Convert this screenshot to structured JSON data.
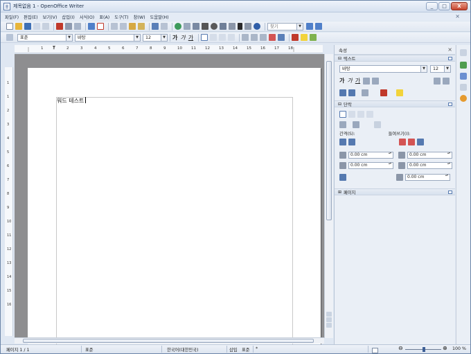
{
  "window": {
    "title": "제목없음 1 - OpenOffice Writer",
    "controls": [
      "_",
      "□",
      "X"
    ]
  },
  "menu": [
    "파일(F)",
    "편집(E)",
    "보기(V)",
    "삽입(I)",
    "서식(O)",
    "표(A)",
    "도구(T)",
    "창(W)",
    "도움말(H)"
  ],
  "toolbar": {
    "find_placeholder": "찾기"
  },
  "format_toolbar": {
    "style": "표준",
    "font": "바탕",
    "size": "12",
    "bold": "가",
    "italic": "가",
    "underline": "가"
  },
  "ruler": {
    "marks": [
      "1",
      "1",
      "2",
      "3",
      "4",
      "5",
      "6",
      "7",
      "8",
      "9",
      "10",
      "11",
      "12",
      "13",
      "14",
      "15",
      "16",
      "17",
      "18"
    ],
    "vmarks": [
      "1",
      "1",
      "2",
      "3",
      "4",
      "5",
      "6",
      "7",
      "8",
      "9",
      "10",
      "11",
      "12",
      "13",
      "14",
      "15",
      "16"
    ]
  },
  "document": {
    "text": "워드 테스트"
  },
  "sidebar": {
    "title": "속성",
    "text_section": "텍스트",
    "font": "바탕",
    "size": "12",
    "paragraph_section": "단락",
    "spacing_label": "간격(S):",
    "indent_label": "들여쓰기(I):",
    "spin_values": [
      "0.00 cm",
      "0.00 cm",
      "0.00 cm",
      "0.00 cm",
      "0.00 cm"
    ],
    "page_section": "페이지"
  },
  "statusbar": {
    "page": "페이지 1 / 1",
    "style": "표준",
    "language": "한국어(대한민국)",
    "insert_mode": "삽입",
    "selection_mode": "표준",
    "zoom": "100 %"
  },
  "colors": {
    "accent": "#5579b0",
    "document_bg": "#8e8e90"
  }
}
